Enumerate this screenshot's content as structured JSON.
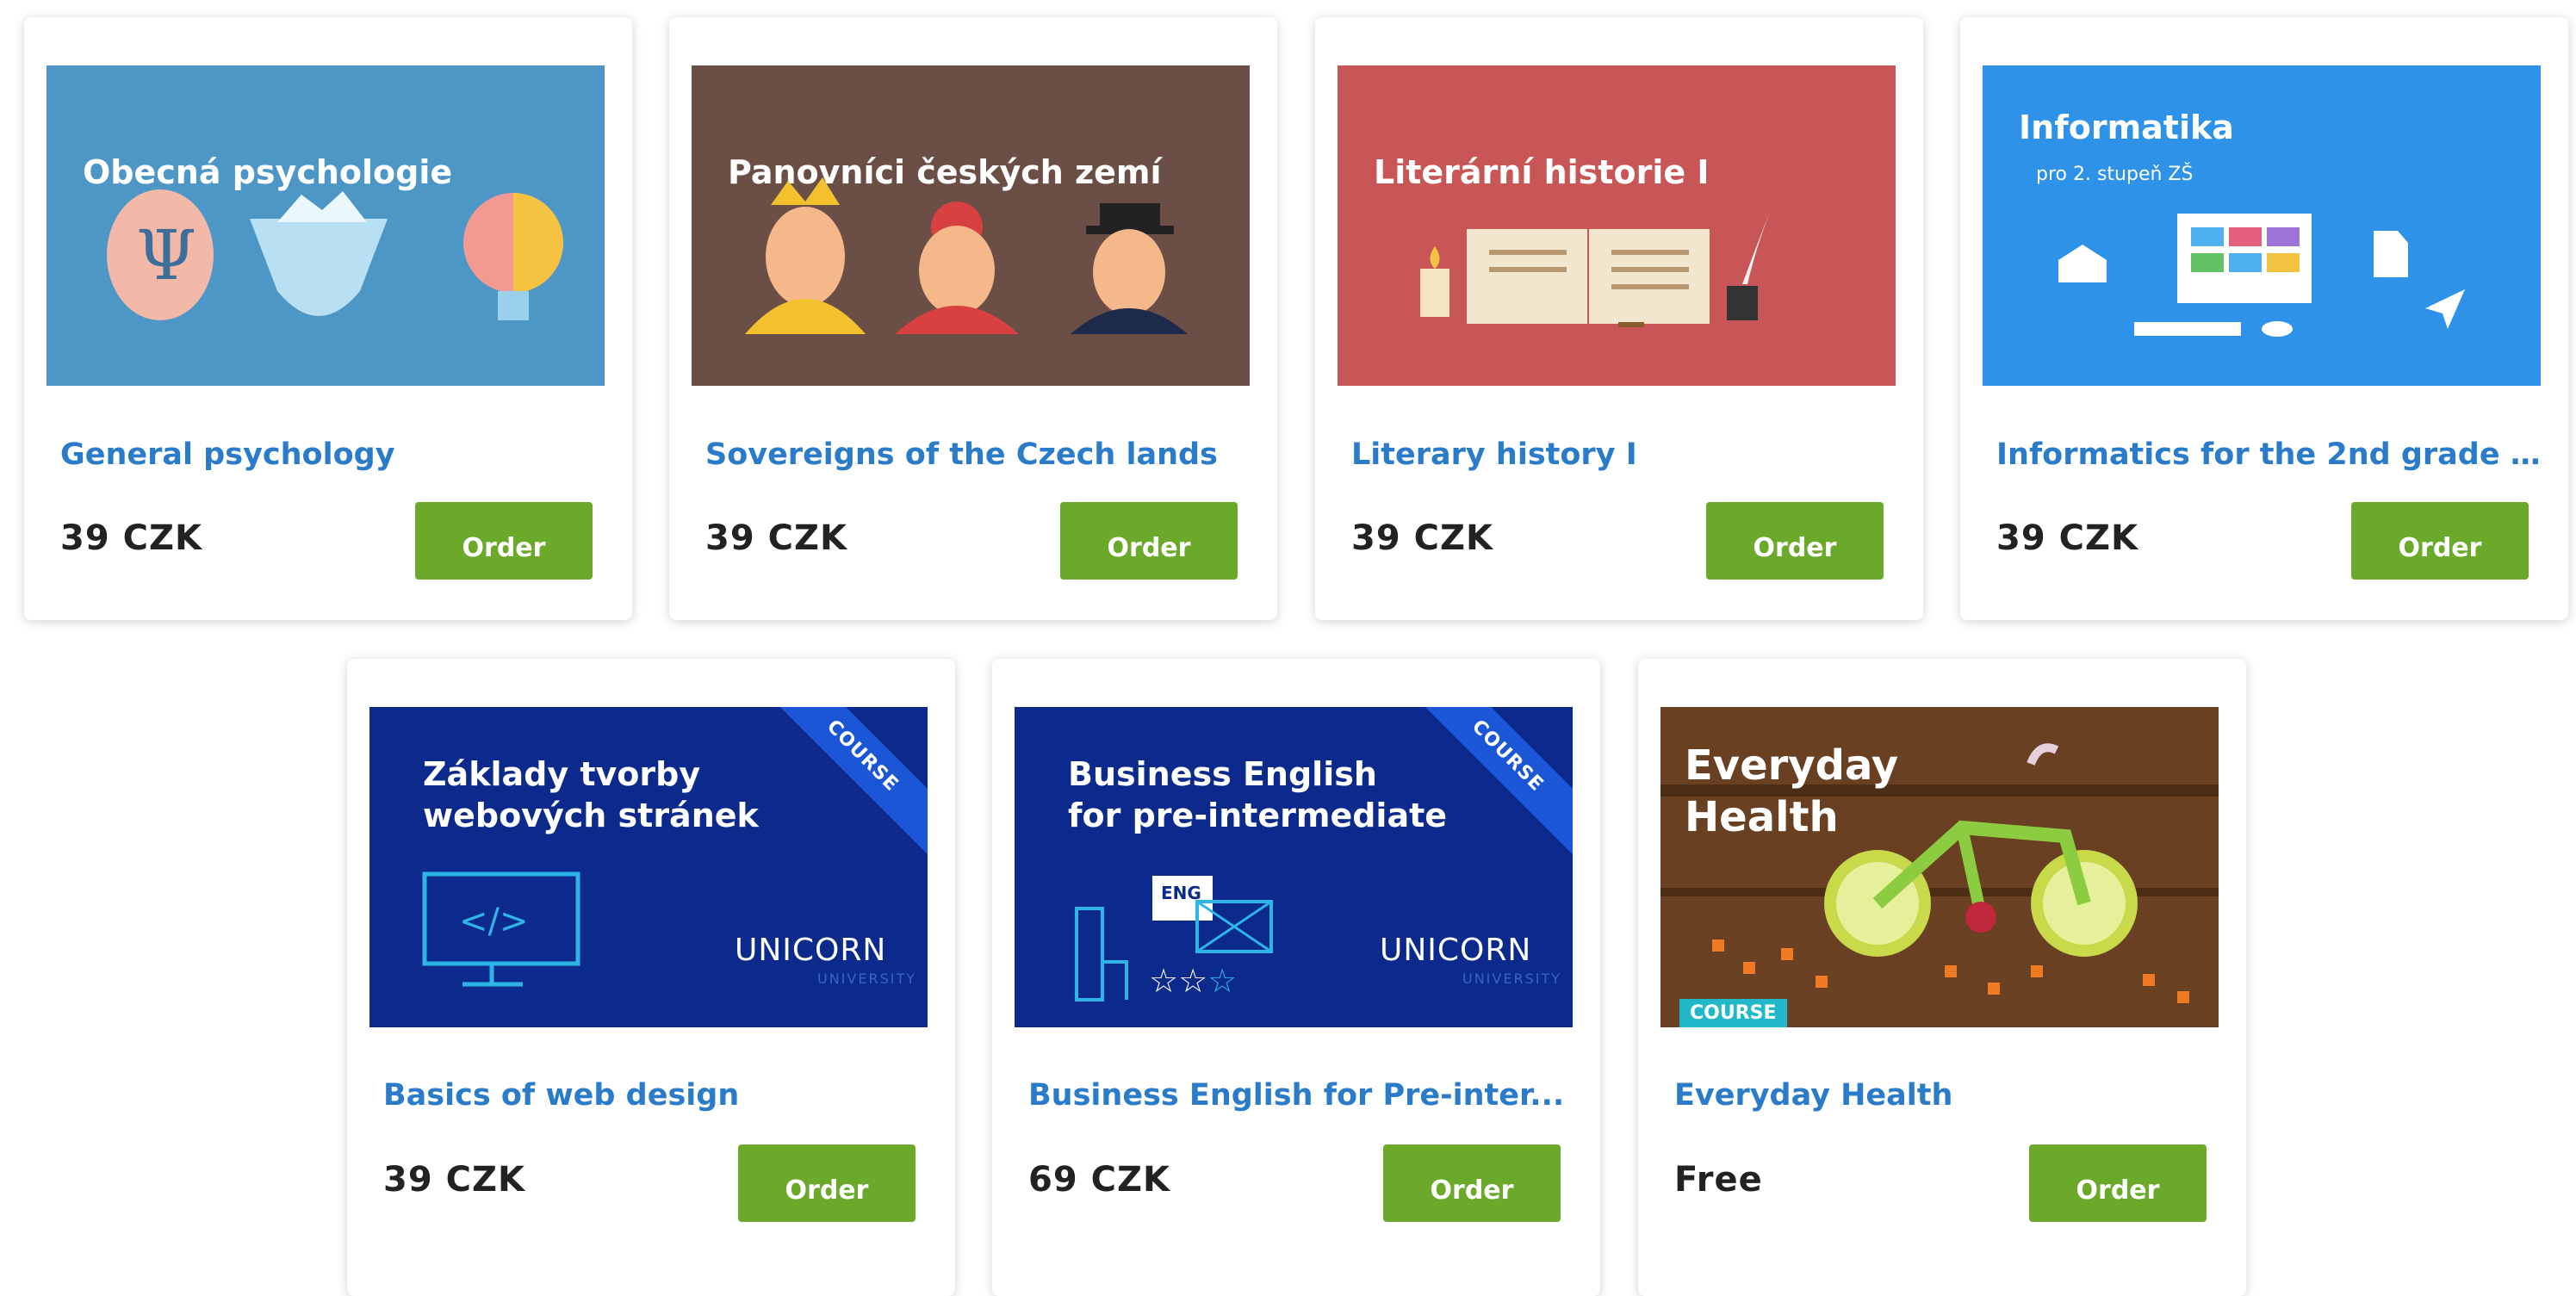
{
  "order_label": "Order",
  "courses": [
    {
      "name": "General psychology",
      "price": "39 CZK",
      "thumbnail_title": "Obecná psychologie",
      "bg": "#4d97c7"
    },
    {
      "name": "Sovereigns of the Czech lands",
      "price": "39 CZK",
      "thumbnail_title": "Panovníci českých zemí",
      "bg": "#6b4e45"
    },
    {
      "name": "Literary history I",
      "price": "39 CZK",
      "thumbnail_title": "Literární historie I",
      "bg": "#c85656"
    },
    {
      "name": "Informatics for the 2nd grade ...",
      "price": "39 CZK",
      "thumbnail_title": "Informatika",
      "thumbnail_subtitle": "pro 2. stupeň ZŠ",
      "bg": "#2e92e8"
    },
    {
      "name": "Basics of web design",
      "price": "39 CZK",
      "thumbnail_title": "Základy tvorby\nwebových stránek",
      "badge": "COURSE",
      "brand": "UNICORN",
      "brand_sub": "UNIVERSITY",
      "bg": "#0b2a8c"
    },
    {
      "name": "Business English for Pre-inter...",
      "price": "69 CZK",
      "thumbnail_title": "Business English\nfor pre-intermediate",
      "thumbnail_tag": "ENG",
      "badge": "COURSE",
      "brand": "UNICORN",
      "brand_sub": "UNIVERSITY",
      "bg": "#0b2a8c"
    },
    {
      "name": "Everyday Health",
      "price": "Free",
      "thumbnail_title": "Everyday\nHealth",
      "badge": "COURSE",
      "bg": "#5a3519"
    }
  ]
}
